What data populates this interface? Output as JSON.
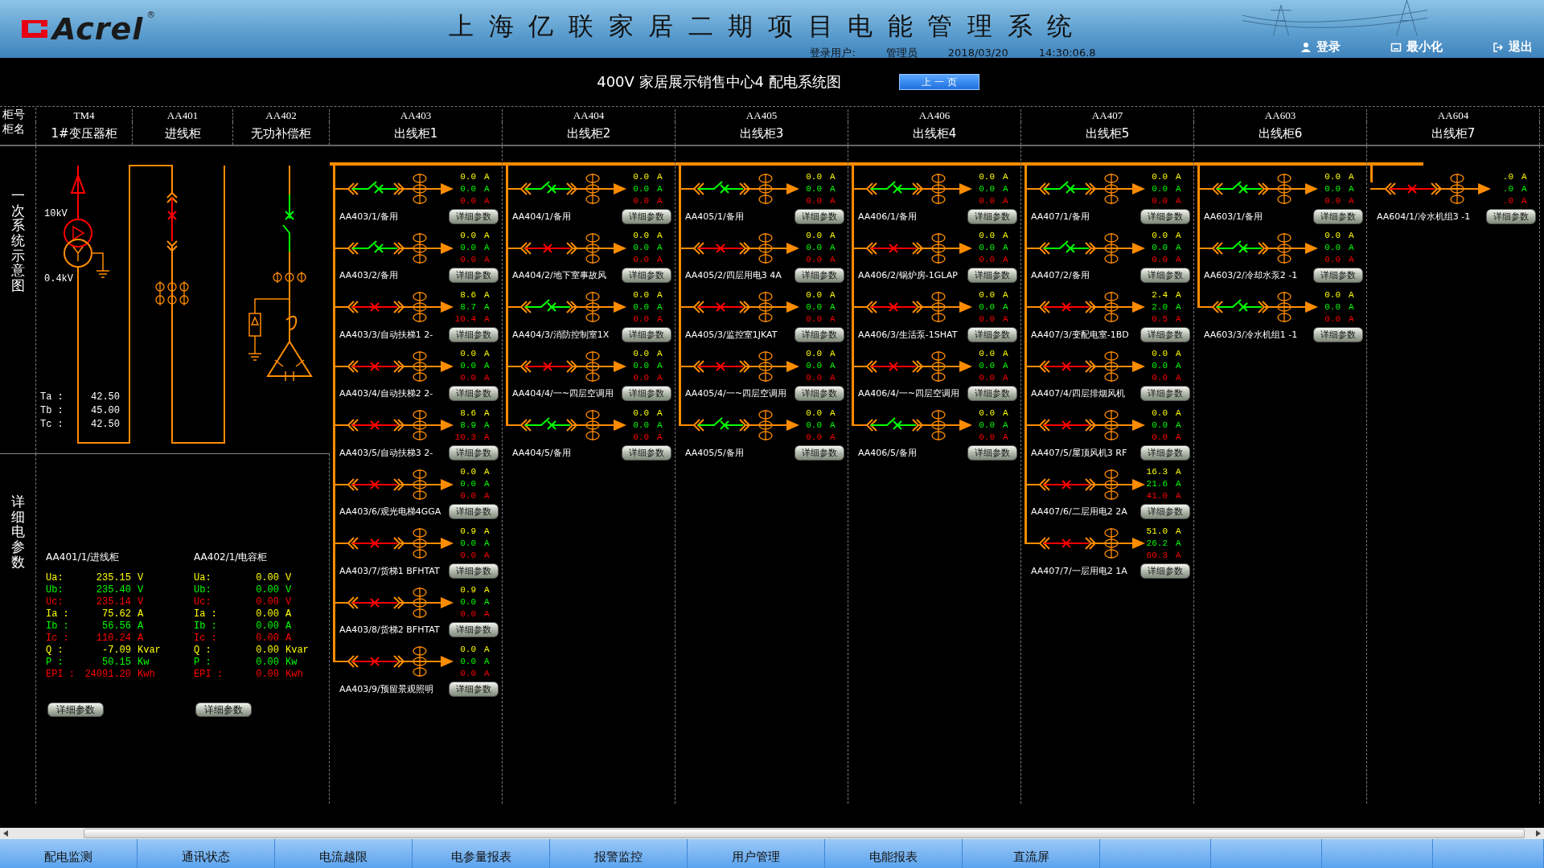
{
  "header": {
    "logo": "Acrel",
    "logo_mark": "®",
    "title": "上海亿联家居二期项目电能管理系统",
    "login_label": "登录用户:",
    "user": "管理员",
    "date": "2018/03/20",
    "time": "14:30:06.8",
    "buttons": [
      {
        "kind": "login",
        "label": "登录"
      },
      {
        "kind": "minimize",
        "label": "最小化"
      },
      {
        "kind": "exit",
        "label": "退出"
      }
    ]
  },
  "subtitle": "400V 家居展示销售中心4 配电系统图",
  "prev_button": "上 一 页",
  "row_labels": [
    "柜号",
    "柜名"
  ],
  "cabinets": [
    {
      "code": "TM4",
      "name": "1#变压器柜"
    },
    {
      "code": "AA401",
      "name": "进线柜"
    },
    {
      "code": "AA402",
      "name": "无功补偿柜"
    },
    {
      "code": "AA403",
      "name": "出线柜1"
    },
    {
      "code": "AA404",
      "name": "出线柜2"
    },
    {
      "code": "AA405",
      "name": "出线柜3"
    },
    {
      "code": "AA406",
      "name": "出线柜4"
    },
    {
      "code": "AA407",
      "name": "出线柜5"
    },
    {
      "code": "AA603",
      "name": "出线柜6"
    },
    {
      "code": "AA604",
      "name": "出线柜7"
    }
  ],
  "side_labels": [
    "一次系统示意图",
    "详细电参数"
  ],
  "transformer": {
    "hv": "10kV",
    "lv": "0.4kV",
    "temperatures": [
      {
        "label": "Ta :",
        "value": "42.50"
      },
      {
        "label": "Tb :",
        "value": "45.00"
      },
      {
        "label": "Tc :",
        "value": "42.50"
      }
    ]
  },
  "meters": [
    {
      "title": "AA401/1/进线柜",
      "rows": [
        {
          "label": "Ua:",
          "value": "235.15",
          "unit": "V"
        },
        {
          "label": "Ub:",
          "value": "235.40",
          "unit": "V"
        },
        {
          "label": "Uc:",
          "value": "235.14",
          "unit": "V"
        },
        {
          "label": "Ia :",
          "value": "75.62",
          "unit": "A"
        },
        {
          "label": "Ib :",
          "value": "56.56",
          "unit": "A"
        },
        {
          "label": "Ic :",
          "value": "110.24",
          "unit": "A"
        },
        {
          "label": "Q :",
          "value": "-7.09",
          "unit": "Kvar"
        },
        {
          "label": "P :",
          "value": "50.15",
          "unit": "Kw"
        },
        {
          "label": "EPI :",
          "value": "24091.20",
          "unit": "Kwh"
        }
      ],
      "button": "详细参数"
    },
    {
      "title": "AA402/1/电容柜",
      "rows": [
        {
          "label": "Ua:",
          "value": "0.00",
          "unit": "V"
        },
        {
          "label": "Ub:",
          "value": "0.00",
          "unit": "V"
        },
        {
          "label": "Uc:",
          "value": "0.00",
          "unit": "V"
        },
        {
          "label": "Ia :",
          "value": "0.00",
          "unit": "A"
        },
        {
          "label": "Ib :",
          "value": "0.00",
          "unit": "A"
        },
        {
          "label": "Ic :",
          "value": "0.00",
          "unit": "A"
        },
        {
          "label": "Q :",
          "value": "0.00",
          "unit": "Kvar"
        },
        {
          "label": "P :",
          "value": "0.00",
          "unit": "Kw"
        },
        {
          "label": "EPI :",
          "value": "0.00",
          "unit": "Kwh"
        }
      ],
      "button": "详细参数"
    }
  ],
  "columns": [
    {
      "feeders": [
        {
          "label": "AA403/1/备用",
          "closed": false,
          "readings": [
            {
              "value": "0.0",
              "unit": "A"
            },
            {
              "value": "0.0",
              "unit": "A"
            },
            {
              "value": "0.0",
              "unit": "A"
            }
          ],
          "button": "详细参数"
        },
        {
          "label": "AA403/2/备用",
          "closed": false,
          "readings": [
            {
              "value": "0.0",
              "unit": "A"
            },
            {
              "value": "0.0",
              "unit": "A"
            },
            {
              "value": "0.0",
              "unit": "A"
            }
          ],
          "button": "详细参数"
        },
        {
          "label": "AA403/3/自动扶梯1 2-",
          "closed": true,
          "readings": [
            {
              "value": "8.6",
              "unit": "A"
            },
            {
              "value": "8.7",
              "unit": "A"
            },
            {
              "value": "10.4",
              "unit": "A"
            }
          ],
          "button": "详细参数"
        },
        {
          "label": "AA403/4/自动扶梯2 2-",
          "closed": true,
          "readings": [
            {
              "value": "0.0",
              "unit": "A"
            },
            {
              "value": "0.0",
              "unit": "A"
            },
            {
              "value": "0.0",
              "unit": "A"
            }
          ],
          "button": "详细参数"
        },
        {
          "label": "AA403/5/自动扶梯3 2-",
          "closed": true,
          "readings": [
            {
              "value": "8.6",
              "unit": "A"
            },
            {
              "value": "8.9",
              "unit": "A"
            },
            {
              "value": "10.3",
              "unit": "A"
            }
          ],
          "button": "详细参数"
        },
        {
          "label": "AA403/6/观光电梯4GGA",
          "closed": true,
          "readings": [
            {
              "value": "0.0",
              "unit": "A"
            },
            {
              "value": "0.0",
              "unit": "A"
            },
            {
              "value": "0.0",
              "unit": "A"
            }
          ],
          "button": "详细参数"
        },
        {
          "label": "AA403/7/货梯1 BFHTAT",
          "closed": true,
          "readings": [
            {
              "value": "0.9",
              "unit": "A"
            },
            {
              "value": "0.0",
              "unit": "A"
            },
            {
              "value": "0.0",
              "unit": "A"
            }
          ],
          "button": "详细参数"
        },
        {
          "label": "AA403/8/货梯2 BFHTAT",
          "closed": true,
          "readings": [
            {
              "value": "0.9",
              "unit": "A"
            },
            {
              "value": "0.0",
              "unit": "A"
            },
            {
              "value": "0.0",
              "unit": "A"
            }
          ],
          "button": "详细参数"
        },
        {
          "label": "AA403/9/预留景观照明",
          "closed": true,
          "readings": [
            {
              "value": "0.0",
              "unit": "A"
            },
            {
              "value": "0.0",
              "unit": "A"
            },
            {
              "value": "0.0",
              "unit": "A"
            }
          ],
          "button": "详细参数"
        }
      ]
    },
    {
      "feeders": [
        {
          "label": "AA404/1/备用",
          "closed": false,
          "readings": [
            {
              "value": "0.0",
              "unit": "A"
            },
            {
              "value": "0.0",
              "unit": "A"
            },
            {
              "value": "0.0",
              "unit": "A"
            }
          ],
          "button": "详细参数"
        },
        {
          "label": "AA404/2/地下室事故风",
          "closed": true,
          "readings": [
            {
              "value": "0.0",
              "unit": "A"
            },
            {
              "value": "0.0",
              "unit": "A"
            },
            {
              "value": "0.0",
              "unit": "A"
            }
          ],
          "button": "详细参数"
        },
        {
          "label": "AA404/3/消防控制室1X",
          "closed": false,
          "readings": [
            {
              "value": "0.0",
              "unit": "A"
            },
            {
              "value": "0.0",
              "unit": "A"
            },
            {
              "value": "0.0",
              "unit": "A"
            }
          ],
          "button": "详细参数"
        },
        {
          "label": "AA404/4/一~四层空调用",
          "closed": true,
          "readings": [
            {
              "value": "0.0",
              "unit": "A"
            },
            {
              "value": "0.0",
              "unit": "A"
            },
            {
              "value": "0.0",
              "unit": "A"
            }
          ],
          "button": "详细参数"
        },
        {
          "label": "AA404/5/备用",
          "closed": false,
          "readings": [
            {
              "value": "0.0",
              "unit": "A"
            },
            {
              "value": "0.0",
              "unit": "A"
            },
            {
              "value": "0.0",
              "unit": "A"
            }
          ],
          "button": "详细参数"
        }
      ]
    },
    {
      "feeders": [
        {
          "label": "AA405/1/备用",
          "closed": false,
          "readings": [
            {
              "value": "0.0",
              "unit": "A"
            },
            {
              "value": "0.0",
              "unit": "A"
            },
            {
              "value": "0.0",
              "unit": "A"
            }
          ],
          "button": "详细参数"
        },
        {
          "label": "AA405/2/四层用电3 4A",
          "closed": true,
          "readings": [
            {
              "value": "0.0",
              "unit": "A"
            },
            {
              "value": "0.0",
              "unit": "A"
            },
            {
              "value": "0.0",
              "unit": "A"
            }
          ],
          "button": "详细参数"
        },
        {
          "label": "AA405/3/监控室1JKAT",
          "closed": true,
          "readings": [
            {
              "value": "0.0",
              "unit": "A"
            },
            {
              "value": "0.0",
              "unit": "A"
            },
            {
              "value": "0.0",
              "unit": "A"
            }
          ],
          "button": "详细参数"
        },
        {
          "label": "AA405/4/一~四层空调用",
          "closed": true,
          "readings": [
            {
              "value": "0.0",
              "unit": "A"
            },
            {
              "value": "0.0",
              "unit": "A"
            },
            {
              "value": "0.0",
              "unit": "A"
            }
          ],
          "button": "详细参数"
        },
        {
          "label": "AA405/5/备用",
          "closed": false,
          "readings": [
            {
              "value": "0.0",
              "unit": "A"
            },
            {
              "value": "0.0",
              "unit": "A"
            },
            {
              "value": "0.0",
              "unit": "A"
            }
          ],
          "button": "详细参数"
        }
      ]
    },
    {
      "feeders": [
        {
          "label": "AA406/1/备用",
          "closed": false,
          "readings": [
            {
              "value": "0.0",
              "unit": "A"
            },
            {
              "value": "0.0",
              "unit": "A"
            },
            {
              "value": "0.0",
              "unit": "A"
            }
          ],
          "button": "详细参数"
        },
        {
          "label": "AA406/2/锅炉房-1GLAP",
          "closed": true,
          "readings": [
            {
              "value": "0.0",
              "unit": "A"
            },
            {
              "value": "0.0",
              "unit": "A"
            },
            {
              "value": "0.0",
              "unit": "A"
            }
          ],
          "button": "详细参数"
        },
        {
          "label": "AA406/3/生活泵-1SHAT",
          "closed": true,
          "readings": [
            {
              "value": "0.0",
              "unit": "A"
            },
            {
              "value": "0.0",
              "unit": "A"
            },
            {
              "value": "0.0",
              "unit": "A"
            }
          ],
          "button": "详细参数"
        },
        {
          "label": "AA406/4/一~四层空调用",
          "closed": true,
          "readings": [
            {
              "value": "0.0",
              "unit": "A"
            },
            {
              "value": "0.0",
              "unit": "A"
            },
            {
              "value": "0.0",
              "unit": "A"
            }
          ],
          "button": "详细参数"
        },
        {
          "label": "AA406/5/备用",
          "closed": false,
          "readings": [
            {
              "value": "0.0",
              "unit": "A"
            },
            {
              "value": "0.0",
              "unit": "A"
            },
            {
              "value": "0.0",
              "unit": "A"
            }
          ],
          "button": "详细参数"
        }
      ]
    },
    {
      "feeders": [
        {
          "label": "AA407/1/备用",
          "closed": false,
          "readings": [
            {
              "value": "0.0",
              "unit": "A"
            },
            {
              "value": "0.0",
              "unit": "A"
            },
            {
              "value": "0.0",
              "unit": "A"
            }
          ],
          "button": "详细参数"
        },
        {
          "label": "AA407/2/备用",
          "closed": false,
          "readings": [
            {
              "value": "0.0",
              "unit": "A"
            },
            {
              "value": "0.0",
              "unit": "A"
            },
            {
              "value": "0.0",
              "unit": "A"
            }
          ],
          "button": "详细参数"
        },
        {
          "label": "AA407/3/变配电室-1BD",
          "closed": true,
          "readings": [
            {
              "value": "2.4",
              "unit": "A"
            },
            {
              "value": "2.0",
              "unit": "A"
            },
            {
              "value": "0.5",
              "unit": "A"
            }
          ],
          "button": "详细参数"
        },
        {
          "label": "AA407/4/四层排烟风机",
          "closed": true,
          "readings": [
            {
              "value": "0.0",
              "unit": "A"
            },
            {
              "value": "0.0",
              "unit": "A"
            },
            {
              "value": "0.0",
              "unit": "A"
            }
          ],
          "button": "详细参数"
        },
        {
          "label": "AA407/5/屋顶风机3 RF",
          "closed": true,
          "readings": [
            {
              "value": "0.0",
              "unit": "A"
            },
            {
              "value": "0.0",
              "unit": "A"
            },
            {
              "value": "0.0",
              "unit": "A"
            }
          ],
          "button": "详细参数"
        },
        {
          "label": "AA407/6/二层用电2 2A",
          "closed": true,
          "readings": [
            {
              "value": "16.3",
              "unit": "A"
            },
            {
              "value": "21.6",
              "unit": "A"
            },
            {
              "value": "41.0",
              "unit": "A"
            }
          ],
          "button": "详细参数"
        },
        {
          "label": "AA407/7/一层用电2 1A",
          "closed": true,
          "readings": [
            {
              "value": "51.0",
              "unit": "A"
            },
            {
              "value": "26.2",
              "unit": "A"
            },
            {
              "value": "60.3",
              "unit": "A"
            }
          ],
          "button": "详细参数"
        }
      ]
    },
    {
      "feeders": [
        {
          "label": "AA603/1/备用",
          "closed": false,
          "readings": [
            {
              "value": "0.0",
              "unit": "A"
            },
            {
              "value": "0.0",
              "unit": "A"
            },
            {
              "value": "0.0",
              "unit": "A"
            }
          ],
          "button": "详细参数"
        },
        {
          "label": "AA603/2/冷却水泵2 -1",
          "closed": false,
          "readings": [
            {
              "value": "0.0",
              "unit": "A"
            },
            {
              "value": "0.0",
              "unit": "A"
            },
            {
              "value": "0.0",
              "unit": "A"
            }
          ],
          "button": "详细参数"
        },
        {
          "label": "AA603/3/冷水机组1 -1",
          "closed": false,
          "readings": [
            {
              "value": "0.0",
              "unit": "A"
            },
            {
              "value": "0.0",
              "unit": "A"
            },
            {
              "value": "0.0",
              "unit": "A"
            }
          ],
          "button": "详细参数"
        }
      ]
    },
    {
      "feeders": [
        {
          "label": "AA604/1/冷水机组3 -1",
          "closed": true,
          "readings": [
            {
              "value": ".0",
              "unit": "A"
            },
            {
              "value": ".0",
              "unit": "A"
            },
            {
              "value": ".0",
              "unit": "A"
            }
          ],
          "button": "详细参数"
        }
      ]
    }
  ],
  "nav": [
    "配电监测",
    "通讯状态",
    "电流越限",
    "电参量报表",
    "报警监控",
    "用户管理",
    "电能报表",
    "直流屏"
  ]
}
